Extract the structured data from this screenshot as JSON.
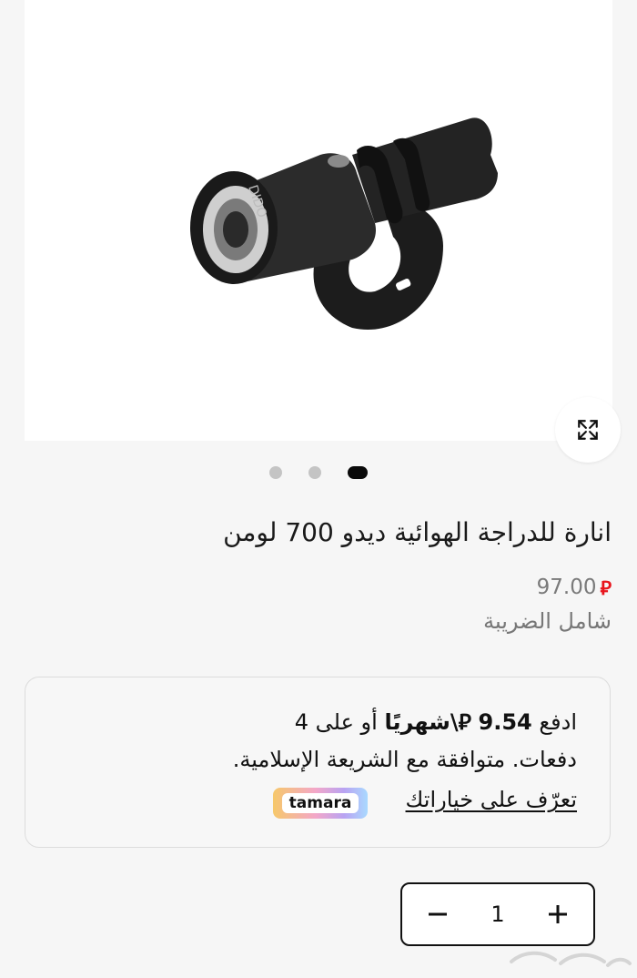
{
  "product": {
    "title": "انارة للدراجة الهوائية ديدو 700 لومن",
    "price": "97.00",
    "currency_symbol": "⃁",
    "tax_note": "شامل الضريبة",
    "image_alt": "Bike front light"
  },
  "gallery": {
    "slide_count": 3,
    "active_index": 0
  },
  "tamara": {
    "pay_prefix": "ادفع",
    "amount": "9.54",
    "currency_symbol": "⃁",
    "per_month": "\\شهريًا",
    "installments_suffix": "أو على 4",
    "line2": "دفعات. متوافقة مع الشريعة الإسلامية.",
    "learn_more": "تعرّف على خياراتك",
    "badge": "tamara"
  },
  "quantity": {
    "value": "1",
    "minus_label": "−",
    "plus_label": "+"
  },
  "colors": {
    "accent_red": "#e8141c",
    "text": "#111111",
    "muted": "#777777"
  },
  "icons": {
    "zoom": "expand-arrows-icon"
  }
}
